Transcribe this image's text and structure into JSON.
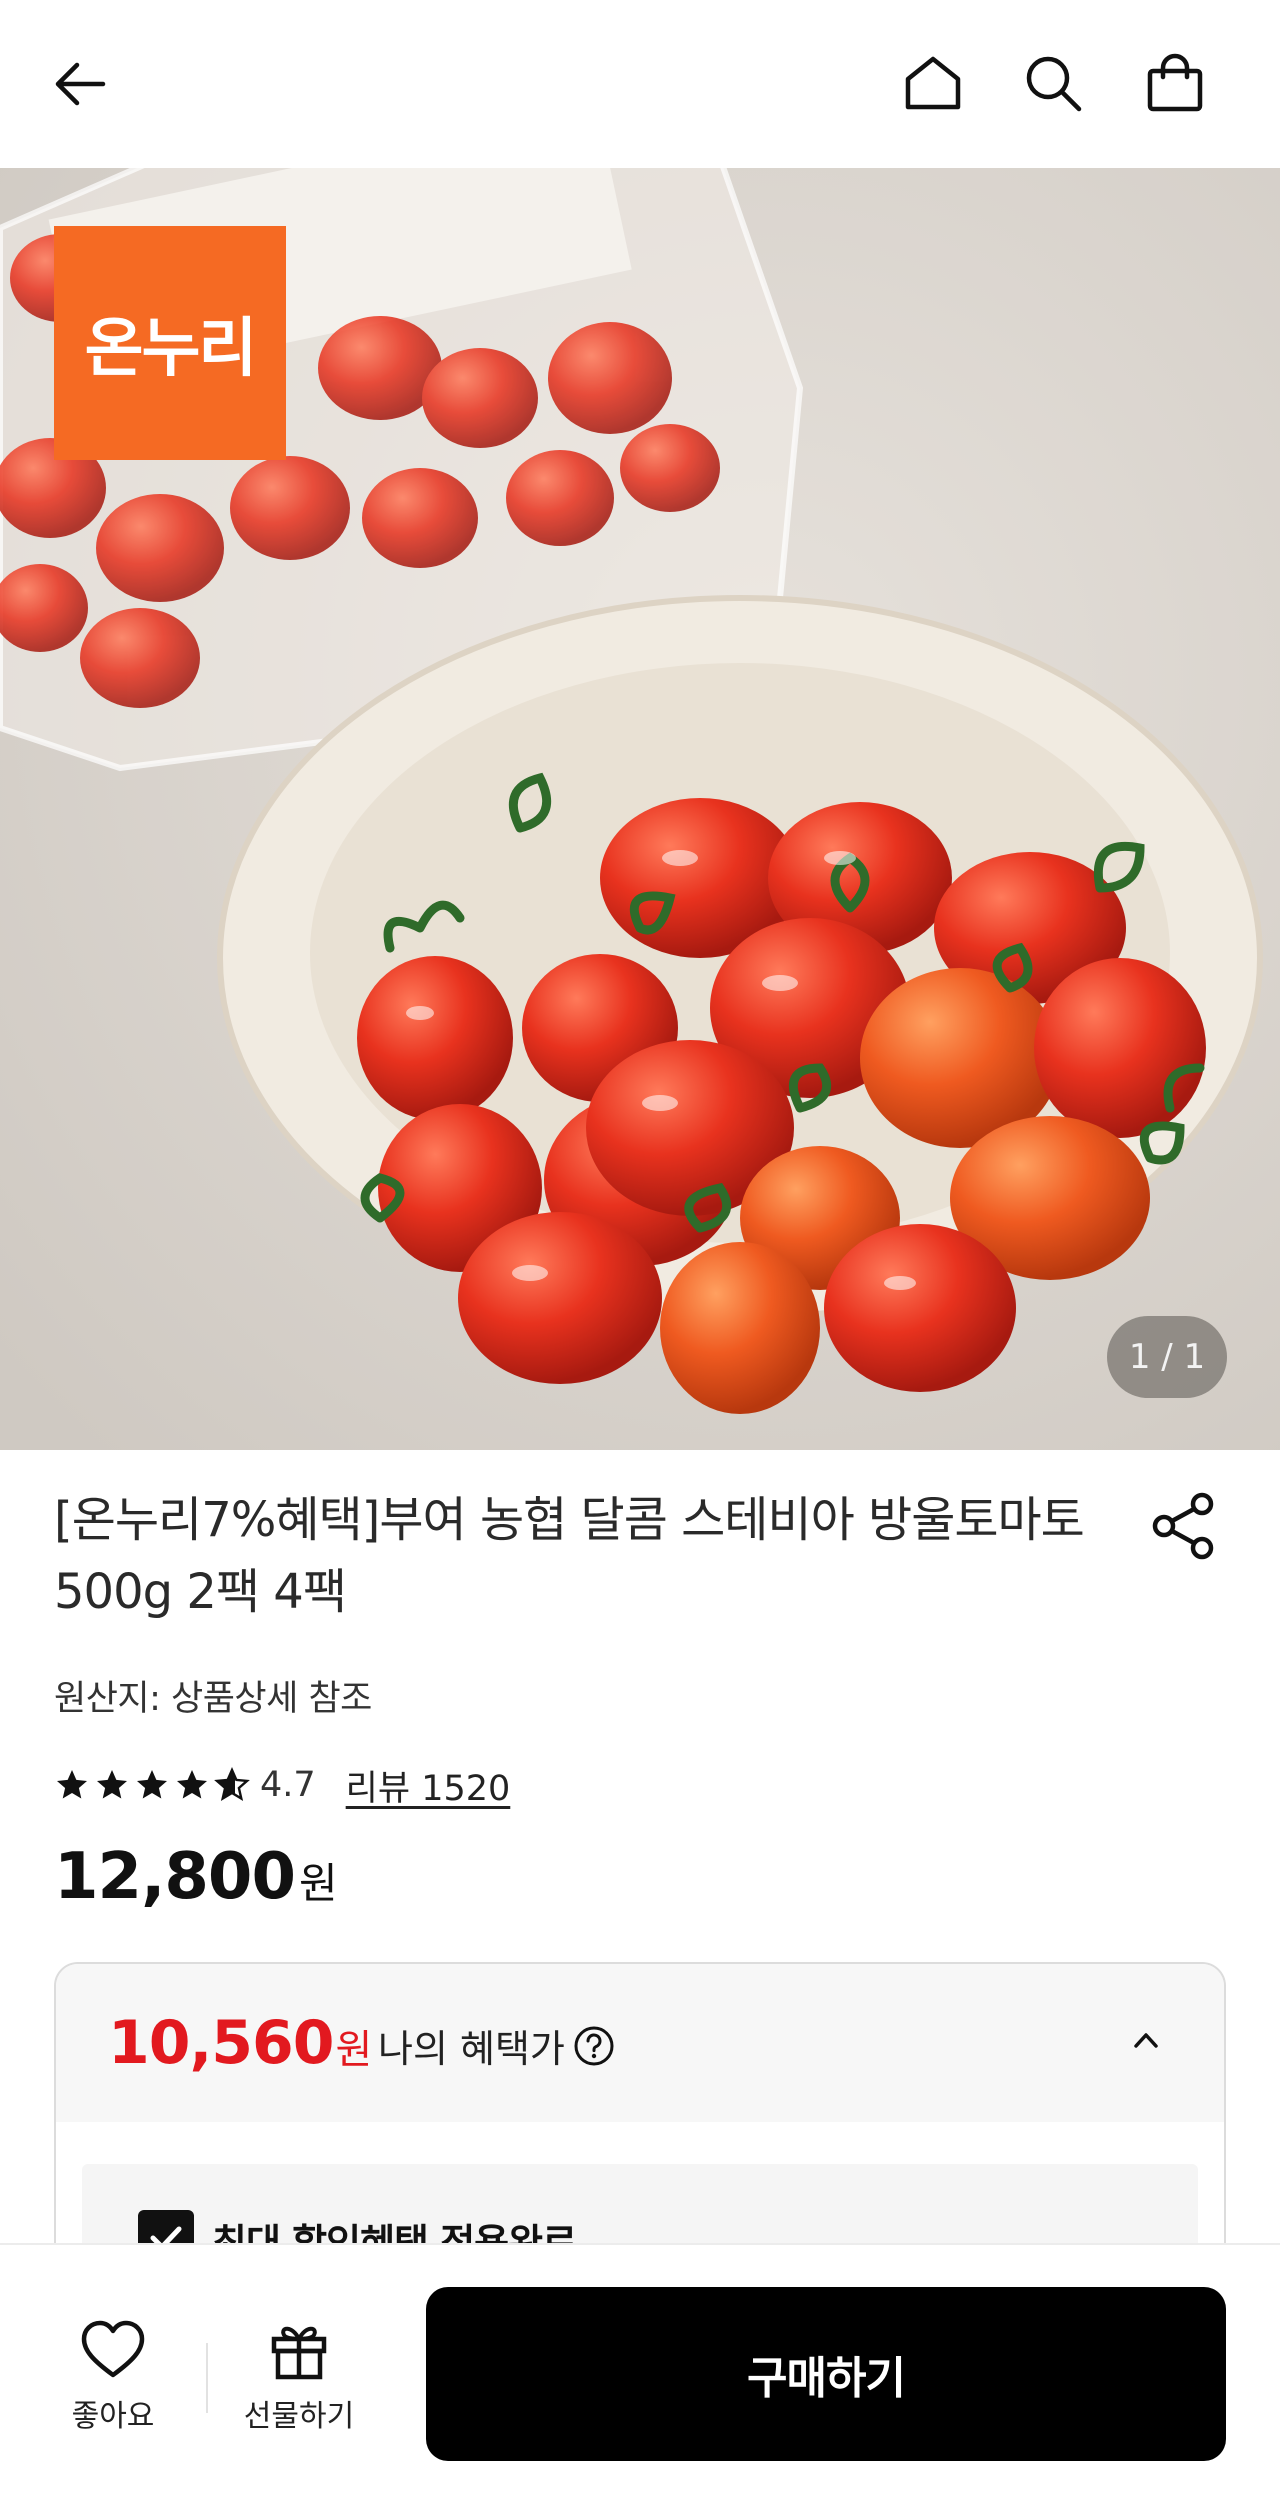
{
  "header": {
    "icons": [
      "back-arrow-icon",
      "home-icon",
      "search-icon",
      "shopping-bag-icon"
    ]
  },
  "gallery": {
    "badge_text": "온누리",
    "page_indicator": "1 / 1"
  },
  "product": {
    "title": "[온누리7%혜택]부여 농협 달콤 스테비아 방울토마토 500g 2팩 4팩",
    "origin": "원산지: 상품상세 참조",
    "rating": "4.7",
    "rating_value": 4.7,
    "review_link": "리뷰 1520",
    "price": "12,800",
    "price_unit": "원"
  },
  "benefit": {
    "price": "10,560",
    "price_unit": "원",
    "label": "나의 혜택가",
    "applied_text": "최대 할인혜택 적용완료"
  },
  "bottom_bar": {
    "like_label": "좋아요",
    "gift_label": "선물하기",
    "buy_label": "구매하기"
  },
  "colors": {
    "accent_red": "#e2191f",
    "badge_orange": "#f56a23",
    "buy_button": "#000000"
  }
}
